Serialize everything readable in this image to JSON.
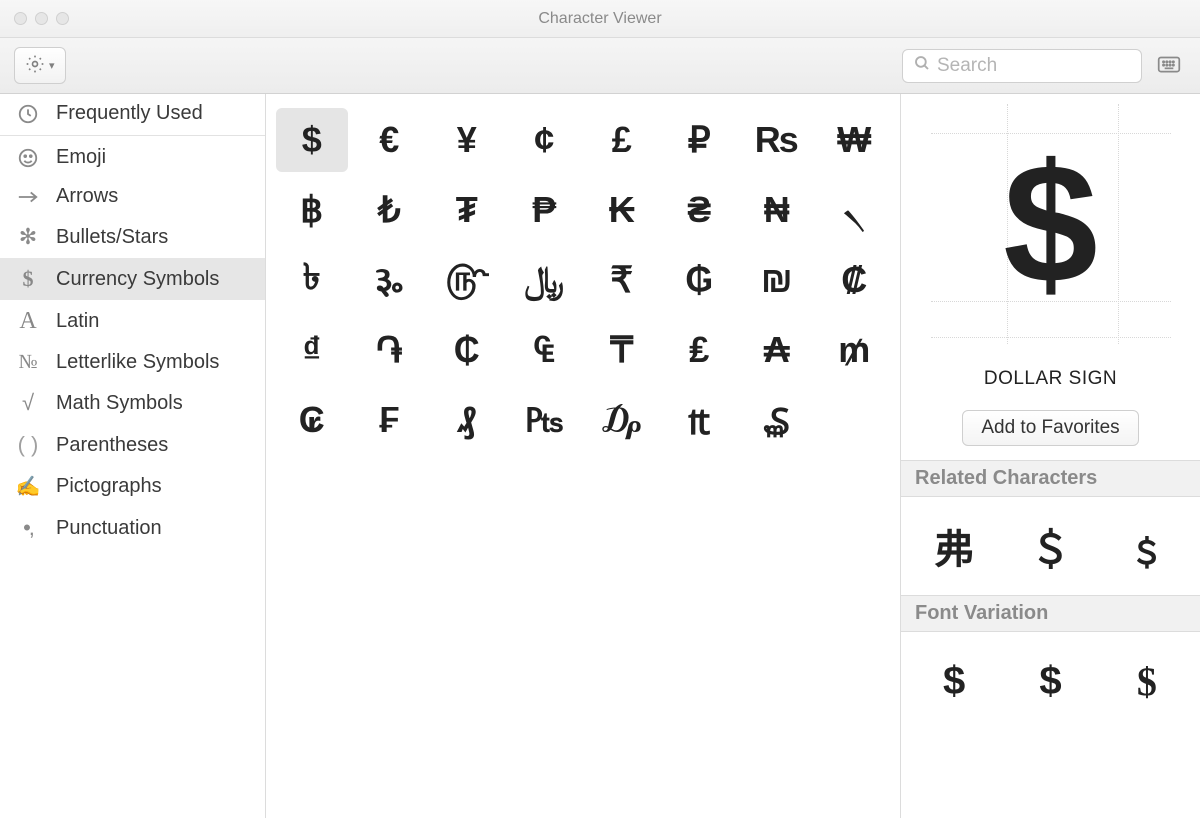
{
  "window": {
    "title": "Character Viewer"
  },
  "toolbar": {
    "search_placeholder": "Search"
  },
  "sidebar": {
    "top_item": {
      "icon": "clock",
      "label": "Frequently Used"
    },
    "items": [
      {
        "icon": "emoji",
        "label": "Emoji"
      },
      {
        "icon": "arrow",
        "label": "Arrows"
      },
      {
        "icon": "star",
        "label": "Bullets/Stars"
      },
      {
        "icon": "dollar",
        "label": "Currency Symbols",
        "selected": true
      },
      {
        "icon": "latin",
        "label": "Latin"
      },
      {
        "icon": "numero",
        "label": "Letterlike Symbols"
      },
      {
        "icon": "root",
        "label": "Math Symbols"
      },
      {
        "icon": "parens",
        "label": "Parentheses"
      },
      {
        "icon": "picto",
        "label": "Pictographs"
      },
      {
        "icon": "punct",
        "label": "Punctuation"
      }
    ]
  },
  "grid": {
    "selected_index": 0,
    "chars": [
      "$",
      "€",
      "¥",
      "¢",
      "£",
      "₽",
      "₨",
      "₩",
      "฿",
      "₺",
      "₮",
      "₱",
      "₭",
      "₴",
      "₦",
      "৲",
      "৳",
      "૱",
      "௹",
      "﷼",
      "₹",
      "₲",
      "₪",
      "₡",
      "₫",
      "֏",
      "₵",
      "₠",
      "₸",
      "₤",
      "₳",
      "₥",
      "₢",
      "₣",
      "₰",
      "₧",
      "₯",
      "₶",
      "₷"
    ]
  },
  "detail": {
    "glyph": "$",
    "name": "DOLLAR SIGN",
    "fav_label": "Add to Favorites",
    "related_header": "Related Characters",
    "related": [
      "弗",
      "＄",
      "﹩"
    ],
    "variation_header": "Font Variation",
    "variations": [
      "$",
      "$",
      "$"
    ]
  }
}
